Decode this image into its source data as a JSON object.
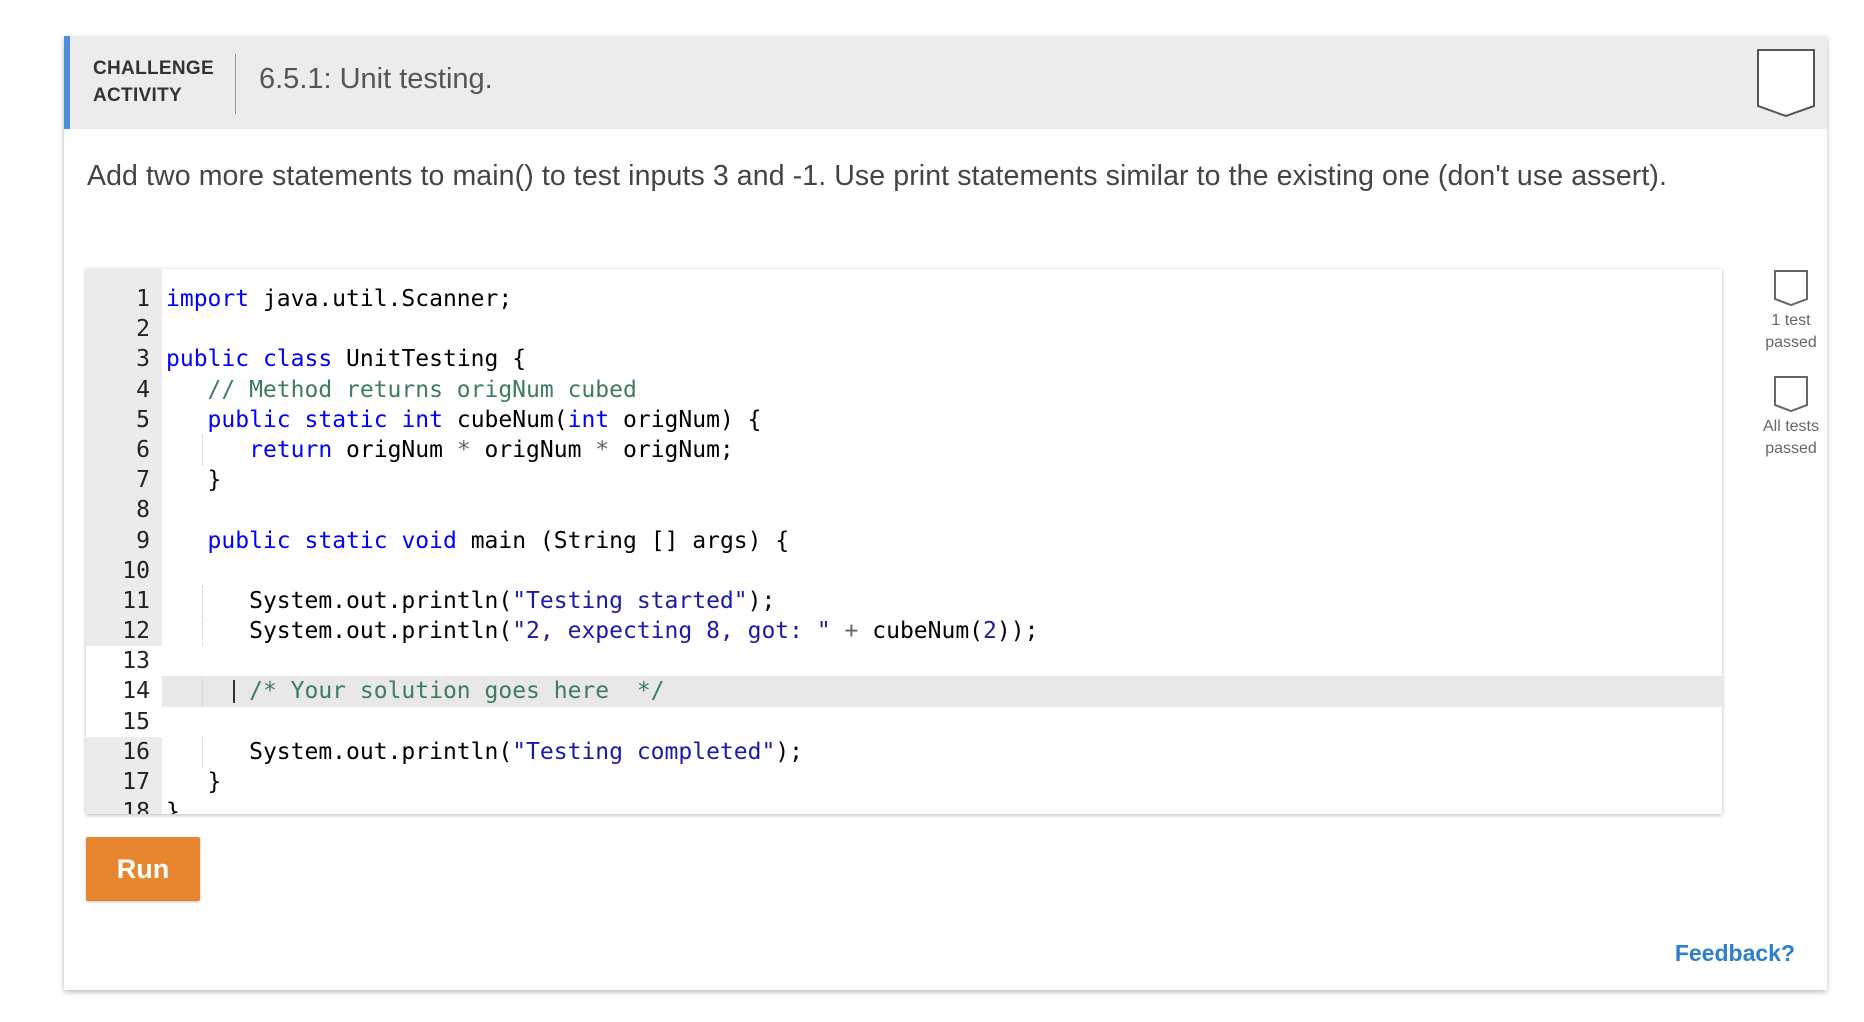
{
  "header": {
    "activity_label": "CHALLENGE ACTIVITY",
    "title": "6.5.1: Unit testing."
  },
  "prompt": "Add two more statements to main() to test inputs 3 and -1. Use print statements similar to the existing one (don't use assert).",
  "editor": {
    "line_numbers": [
      "1",
      "2",
      "3",
      "4",
      "5",
      "6",
      "7",
      "8",
      "9",
      "10",
      "11",
      "12",
      "13",
      "14",
      "15",
      "16",
      "17",
      "18"
    ],
    "code": {
      "l1_kw": "import",
      "l1_rest": " java.util.Scanner;",
      "l3_kw1": "public",
      "l3_kw2": "class",
      "l3_rest": " UnitTesting {",
      "l4_comment": "// Method returns origNum cubed",
      "l5_kw1": "public",
      "l5_kw2": "static",
      "l5_kw3": "int",
      "l5_mid": " cubeNum(",
      "l5_kw4": "int",
      "l5_rest": " origNum) {",
      "l6_kw": "return",
      "l6_a": " origNum ",
      "l6_op1": "*",
      "l6_b": " origNum ",
      "l6_op2": "*",
      "l6_c": " origNum;",
      "l7": "}",
      "l9_kw1": "public",
      "l9_kw2": "static",
      "l9_kw3": "void",
      "l9_mid": " main (String ",
      "l9_br": "[]",
      "l9_rest": " args) {",
      "l11_a": "System.out.println(",
      "l11_str": "\"Testing started\"",
      "l11_b": ");",
      "l12_a": "System.out.println(",
      "l12_str": "\"2, expecting 8, got: \"",
      "l12_op": " + ",
      "l12_b": "cubeNum(",
      "l12_num": "2",
      "l12_c": "));",
      "l14_comment": "/* Your solution goes here  */",
      "l16_a": "System.out.println(",
      "l16_str": "\"Testing completed\"",
      "l16_b": ");",
      "l17": "}",
      "l18": "}"
    }
  },
  "run_button": {
    "label": "Run"
  },
  "tests": [
    {
      "label": "1 test passed",
      "line1": "1 test",
      "line2": "passed"
    },
    {
      "label": "All tests passed",
      "line1": "All tests",
      "line2": "passed"
    }
  ],
  "feedback": {
    "label": "Feedback?"
  },
  "colors": {
    "accent": "#4a90d9",
    "run_button": "#e8862f",
    "link": "#2c7fc9",
    "keyword": "#0000ff",
    "comment": "#3d7c5e"
  }
}
